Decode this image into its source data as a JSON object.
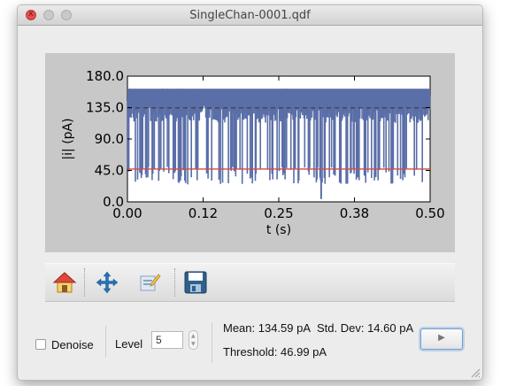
{
  "window": {
    "title": "SingleChan-0001.qdf",
    "close_glyph": "x"
  },
  "colors": {
    "trace": "#5a6ea8",
    "threshold_line": "#d14a4a",
    "mean_line": "#444444",
    "plot_background": "#c8c8c8",
    "axes_background": "#ffffff",
    "accent": "#6ea0d6"
  },
  "chart_data": {
    "type": "line",
    "xlabel": "t (s)",
    "ylabel": "|i| (pA)",
    "xlim": [
      0.0,
      0.5
    ],
    "ylim": [
      0.0,
      180.0
    ],
    "xticks": [
      "0.00",
      "0.12",
      "0.25",
      "0.38",
      "0.50"
    ],
    "yticks": [
      "0.0",
      "45.0",
      "90.0",
      "135.0",
      "180.0"
    ],
    "series": [
      {
        "style": "noisy two-level trace",
        "open_level": 150,
        "closed_level": 35,
        "noise_band": [
          138,
          162
        ],
        "closed_band": [
          25,
          50
        ],
        "x_range": [
          0.0,
          0.5
        ]
      }
    ],
    "reference_lines": [
      {
        "style": "dashed",
        "y": 134.59
      },
      {
        "style": "solid",
        "y": 46.99
      }
    ],
    "grid": false
  },
  "toolbar": {
    "icons": [
      "home-icon",
      "pan-arrows-icon",
      "configure-icon",
      "save-icon"
    ]
  },
  "controls": {
    "denoise_label": "Denoise",
    "denoise_checked": false,
    "level_label": "Level",
    "level_value": "5",
    "mean_text": "Mean: 134.59 pA",
    "stddev_text": "Std. Dev: 14.60 pA",
    "threshold_text": "Threshold: 46.99 pA",
    "play_glyph": "▶"
  }
}
